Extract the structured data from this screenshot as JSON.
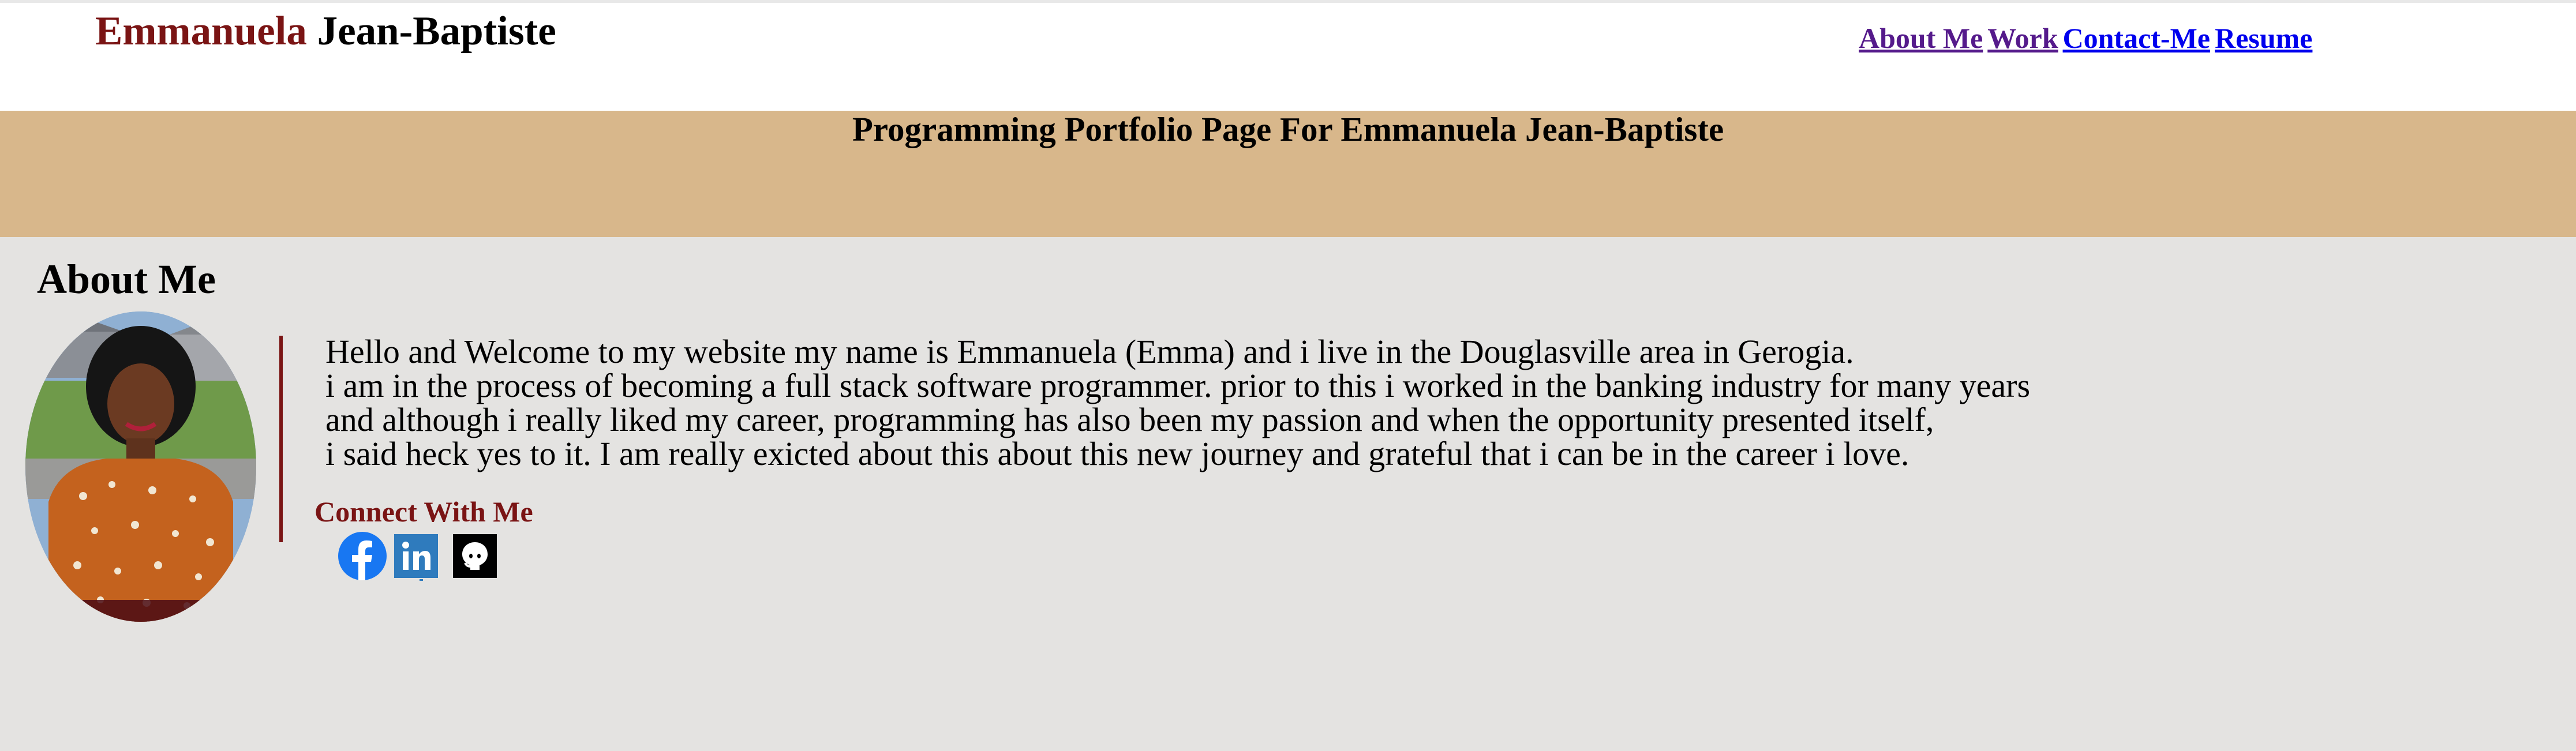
{
  "header": {
    "first_name": "Emmanuela",
    "last_name": "Jean-Baptiste",
    "nav": [
      {
        "label": "About Me",
        "visited": true
      },
      {
        "label": "Work",
        "visited": true
      },
      {
        "label": "Contact-Me",
        "visited": false
      },
      {
        "label": "Resume",
        "visited": false
      }
    ]
  },
  "banner": {
    "title": "Programming Portfolio Page For Emmanuela Jean-Baptiste"
  },
  "about": {
    "heading": "About Me",
    "bio_lines": [
      "Hello and Welcome to my website my name is Emmanuela (Emma) and i live in the Douglasville area in Gerogia.",
      "i am in the process of becoming a full stack software programmer. prior to this i worked in the banking industry for many years",
      "and although i really liked my career, programming has also been my passion and when the opportunity presented itself,",
      "i said heck yes to it. I am really exicted about this about this new journey and grateful that i can be in the career i love."
    ],
    "connect_label": "Connect With Me",
    "social": [
      {
        "name": "facebook-icon",
        "color": "#1877f2"
      },
      {
        "name": "linkedin-icon",
        "color": "#2f7bbd"
      },
      {
        "name": "github-icon",
        "color": "#000000"
      }
    ]
  },
  "colors": {
    "accent": "#7a1414",
    "banner": "#d8b78b",
    "page_background": "#e4e3e1"
  }
}
